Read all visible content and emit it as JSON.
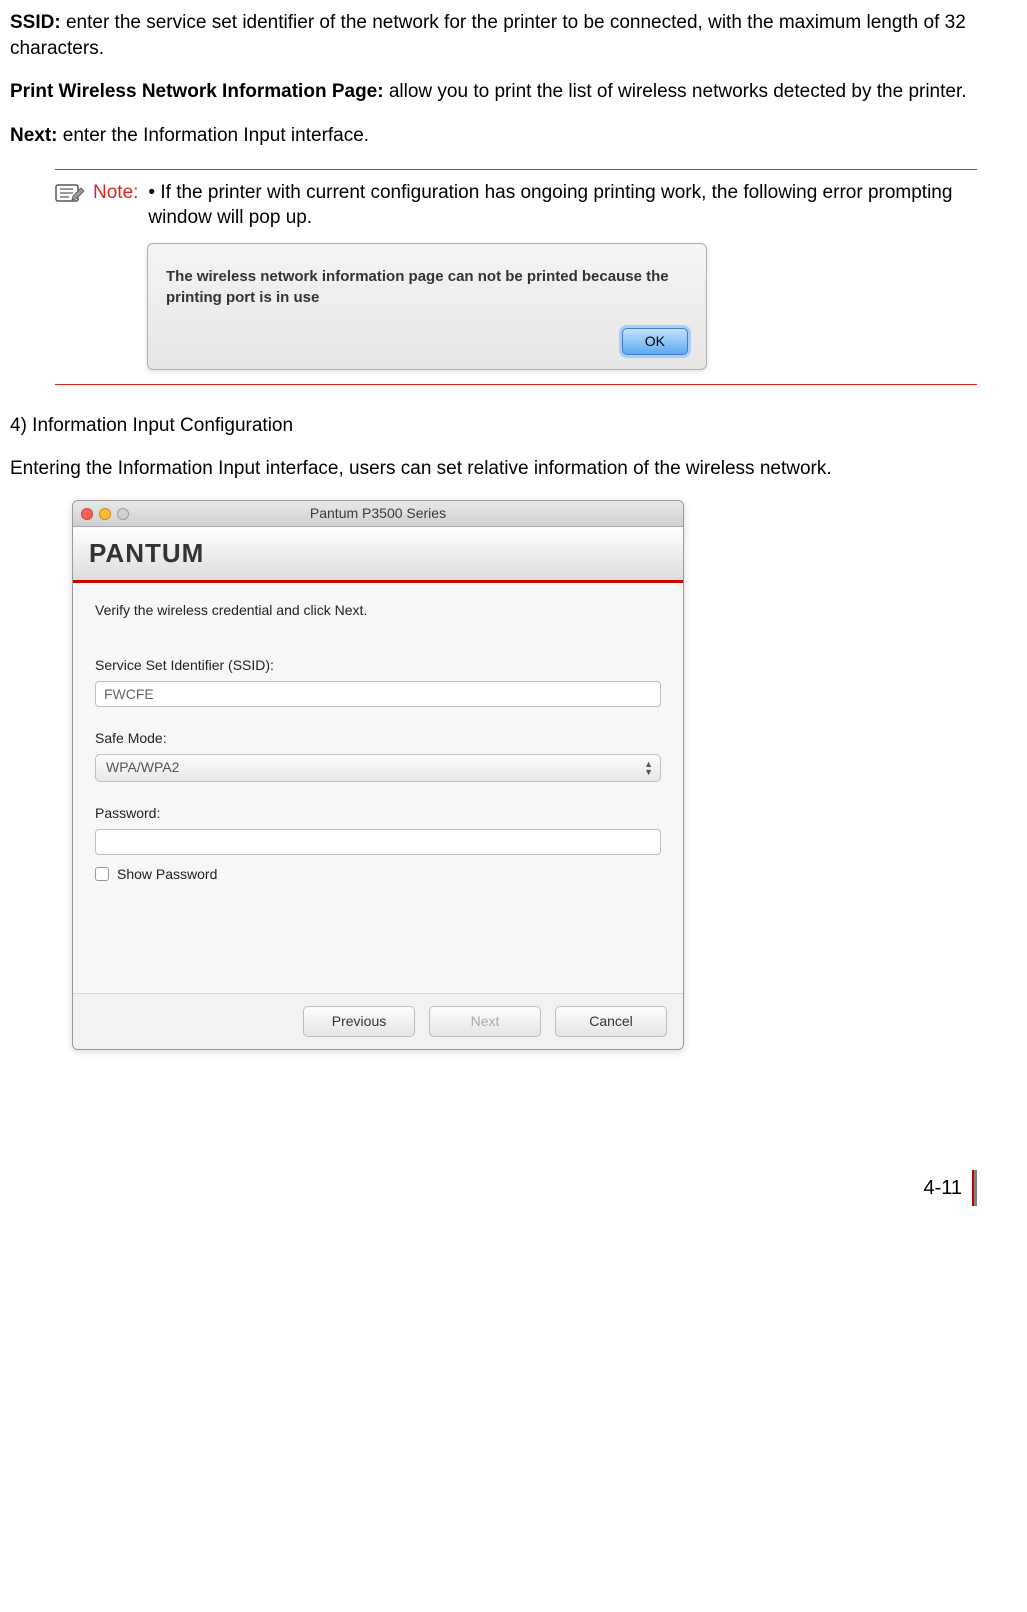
{
  "text": {
    "ssid_bold": "SSID:",
    "ssid_rest": " enter the service set identifier of the network for the printer to be connected, with the maximum length of 32 characters.",
    "print_bold": "Print Wireless Network Information Page:",
    "print_rest": " allow you to print the list of wireless networks detected by the printer.",
    "next_bold": "Next:",
    "next_rest": " enter the Information Input interface.",
    "note_label": "Note:",
    "note_text": "• If the printer with current configuration has ongoing printing work, the following error prompting window will pop up.",
    "section4_heading": "4) Information Input Configuration",
    "section4_para": "Entering the Information Input interface, users can set relative information of the wireless network.",
    "page_number": "4-11"
  },
  "dialog": {
    "message": "The wireless network information page can not be printed because the printing port is in use",
    "ok_label": "OK"
  },
  "app": {
    "window_title": "Pantum P3500 Series",
    "logo_text": "PANTUM",
    "instruction": "Verify the wireless credential and click Next.",
    "ssid_label": "Service Set Identifier (SSID):",
    "ssid_value": "FWCFE",
    "safe_mode_label": "Safe Mode:",
    "safe_mode_value": "WPA/WPA2",
    "password_label": "Password:",
    "password_value": "",
    "show_password_label": "Show Password",
    "btn_previous": "Previous",
    "btn_next": "Next",
    "btn_cancel": "Cancel"
  }
}
